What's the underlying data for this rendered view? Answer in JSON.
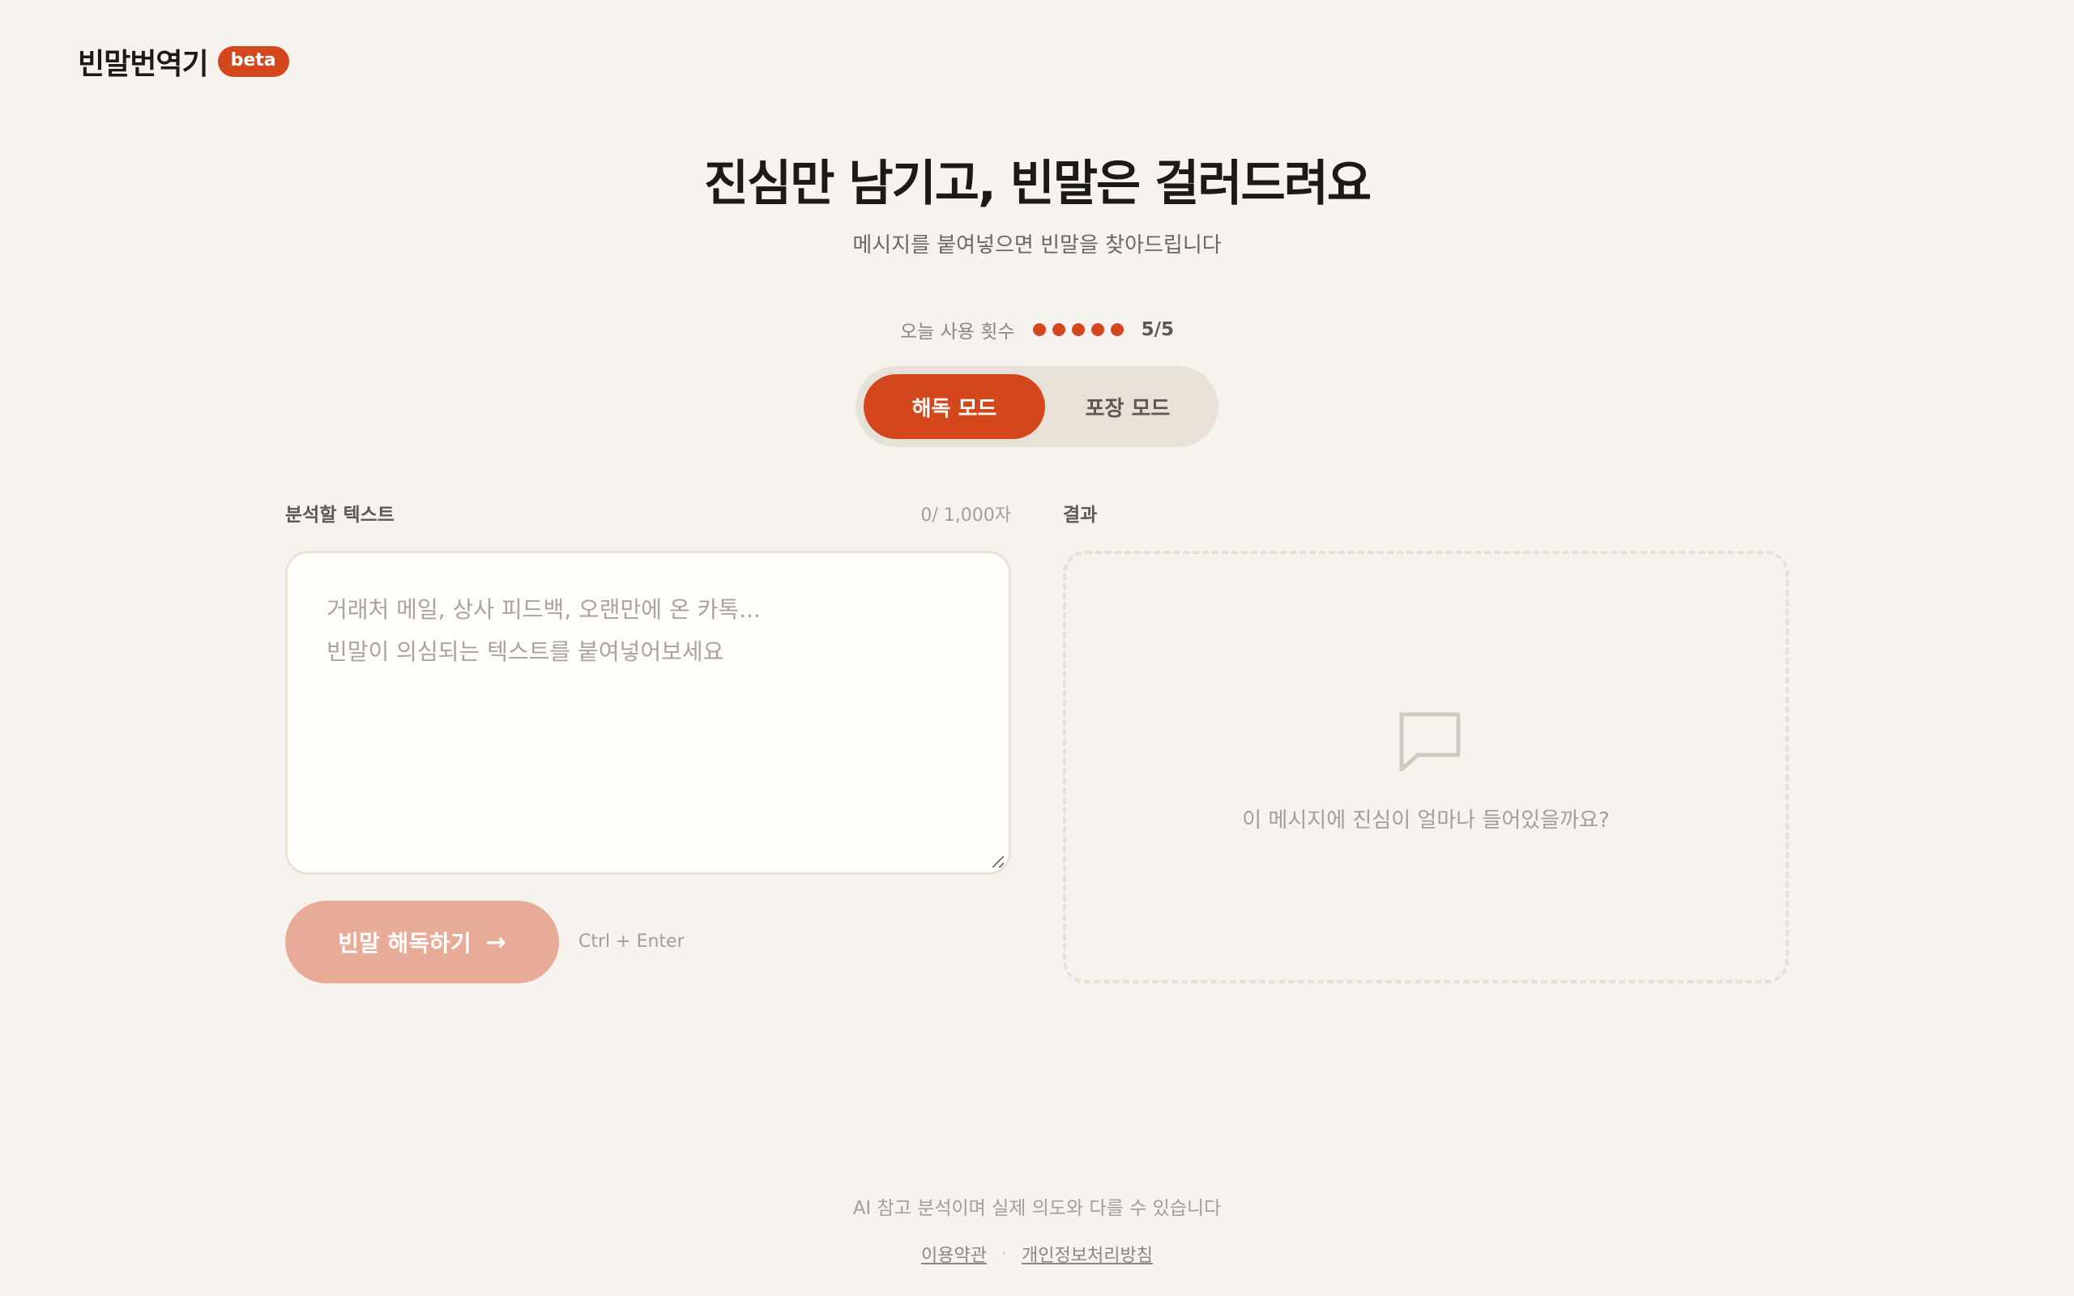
{
  "header": {
    "brand": "빈말번역기",
    "badge": "beta"
  },
  "hero": {
    "title": "진심만 남기고, 빈말은 걸러드려요",
    "subtitle": "메시지를 붙여넣으면 빈말을 찾아드립니다"
  },
  "usage": {
    "label": "오늘 사용 횟수",
    "count": "5/5",
    "used": 5,
    "total": 5
  },
  "modes": {
    "active": "해독 모드",
    "inactive": "포장 모드"
  },
  "input": {
    "label": "분석할 텍스트",
    "char_count": "0/ 1,000자",
    "placeholder_line1": "거래처 메일, 상사 피드백, 오랜만에 온 카톡...",
    "placeholder_line2": "빈말이 의심되는 텍스트를 붙여넣어보세요"
  },
  "submit": {
    "label": "빈말 해독하기",
    "shortcut": "Ctrl + Enter"
  },
  "result": {
    "label": "결과",
    "empty_text": "이 메시지에 진심이 얼마나 들어있을까요?"
  },
  "footer": {
    "note": "AI 참고 분석이며 실제 의도와 다를 수 있습니다",
    "terms": "이용약관",
    "privacy": "개인정보처리방침"
  },
  "colors": {
    "accent": "#d4461c",
    "accent_light": "#e8ab97",
    "background": "#f6f3ee"
  }
}
